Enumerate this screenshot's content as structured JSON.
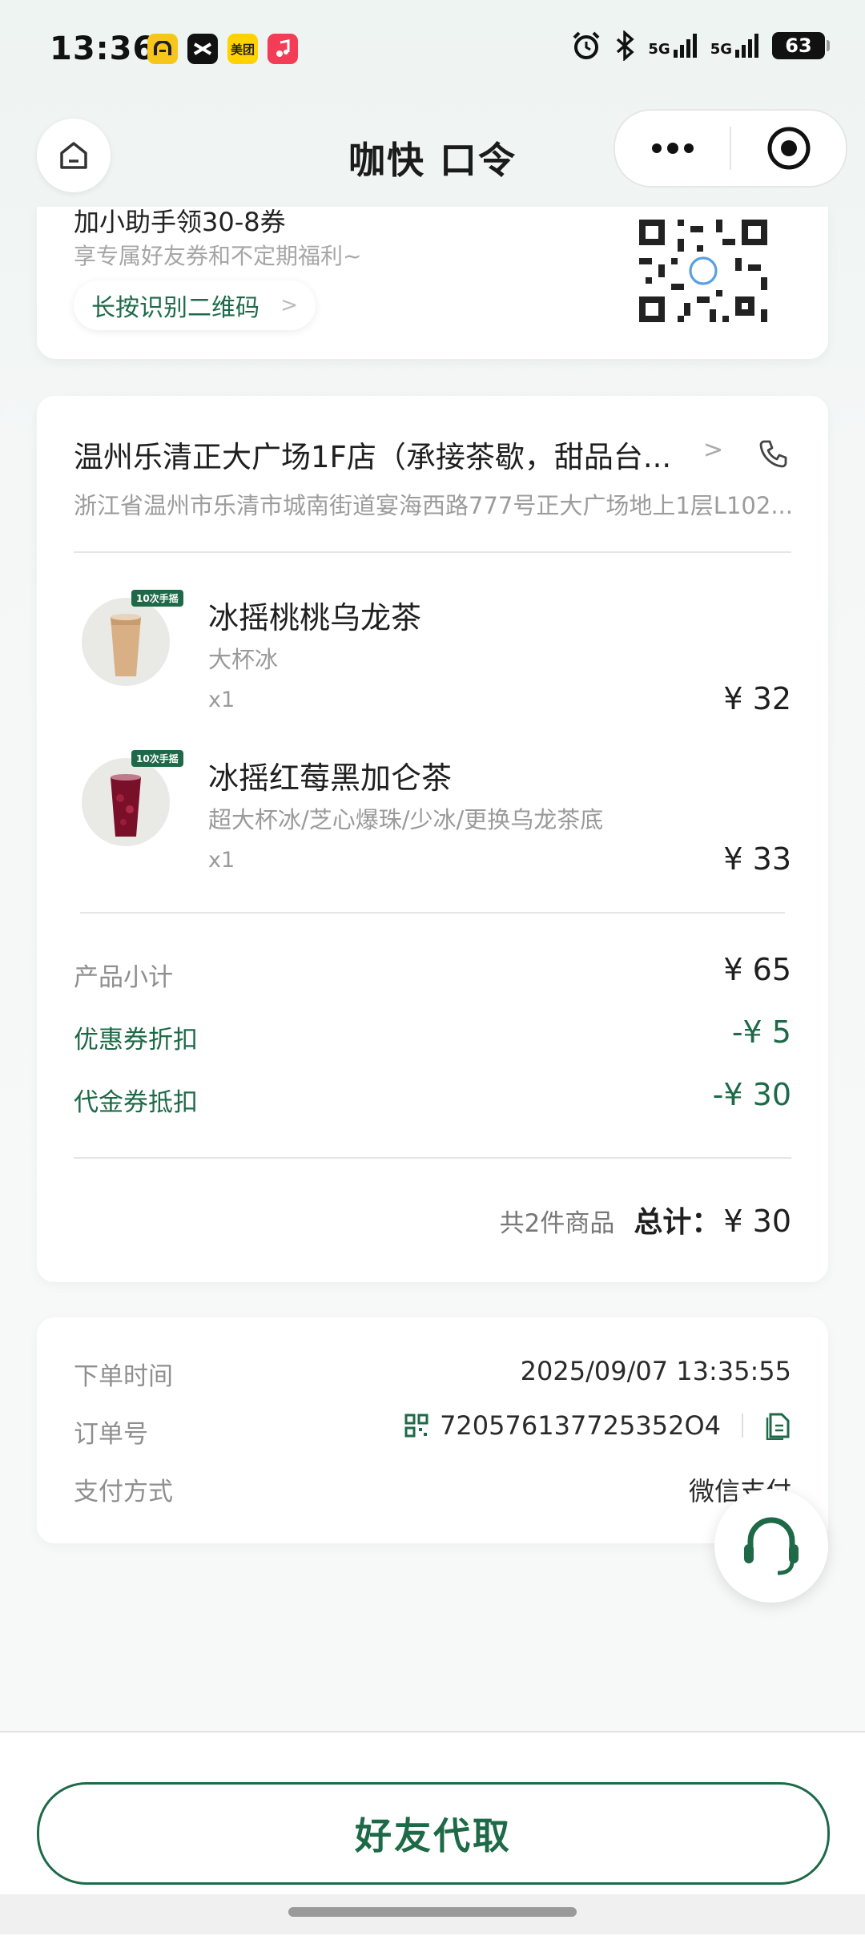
{
  "status_bar": {
    "time": "13:36",
    "apps": [
      "app-icon-a",
      "capcut-icon",
      "美团",
      "music-icon"
    ],
    "battery": "63",
    "signal_labels": [
      "5G",
      "5G"
    ]
  },
  "header": {
    "logo_text": "咖快 口令",
    "colors": {
      "brand_green": "#1e6a48"
    }
  },
  "promo": {
    "top_text": "加小助手领30-8券",
    "subtitle": "享专属好友券和不定期福利~",
    "qr_button": "长按识别二维码"
  },
  "store": {
    "name": "温州乐清正大广场1F店（承接茶歇，甜品台...",
    "address": "浙江省温州市乐清市城南街道宴海西路777号正大广场地上1层L102..."
  },
  "items": [
    {
      "badge": "10次手摇",
      "name": "冰摇桃桃乌龙茶",
      "spec": "大杯冰",
      "qty": "x1",
      "price": "¥ 32"
    },
    {
      "badge": "10次手摇",
      "name": "冰摇红莓黑加仑茶",
      "spec": "超大杯冰/芝心爆珠/少冰/更换乌龙茶底",
      "qty": "x1",
      "price": "¥ 33"
    }
  ],
  "summary": {
    "subtotal_label": "产品小计",
    "subtotal_value": "¥ 65",
    "coupon_label": "优惠券折扣",
    "coupon_value": "-¥ 5",
    "voucher_label": "代金券抵扣",
    "voucher_value": "-¥ 30",
    "count_label": "共2件商品",
    "total_label": "总计：",
    "total_value": "¥ 30"
  },
  "info": {
    "time_label": "下单时间",
    "time_value": "2025/09/07 13:35:55",
    "order_label": "订单号",
    "order_value": "720576137725352O4",
    "pay_label": "支付方式",
    "pay_value": "微信支付"
  },
  "bottom": {
    "friend_button": "好友代取"
  }
}
